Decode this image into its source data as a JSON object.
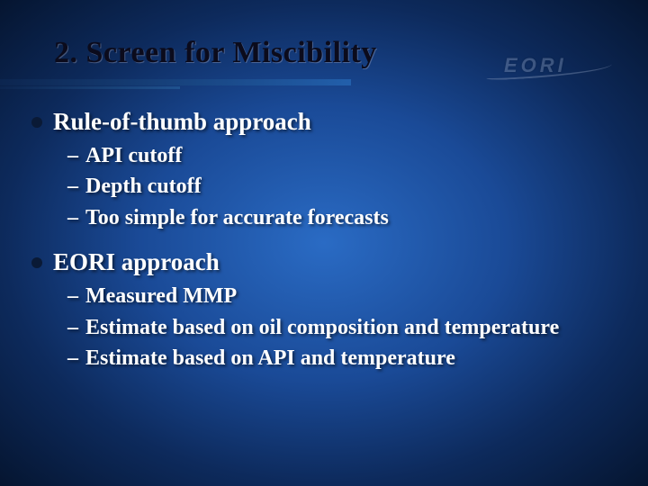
{
  "logo_text": "EORI",
  "title": "2. Screen for Miscibility",
  "bullets": [
    {
      "text": "Rule-of-thumb approach",
      "subs": [
        "API cutoff",
        "Depth cutoff",
        "Too simple for accurate forecasts"
      ]
    },
    {
      "text": "EORI approach",
      "subs": [
        "Measured MMP",
        "Estimate based on oil composition and temperature",
        "Estimate based on API and temperature"
      ]
    }
  ]
}
